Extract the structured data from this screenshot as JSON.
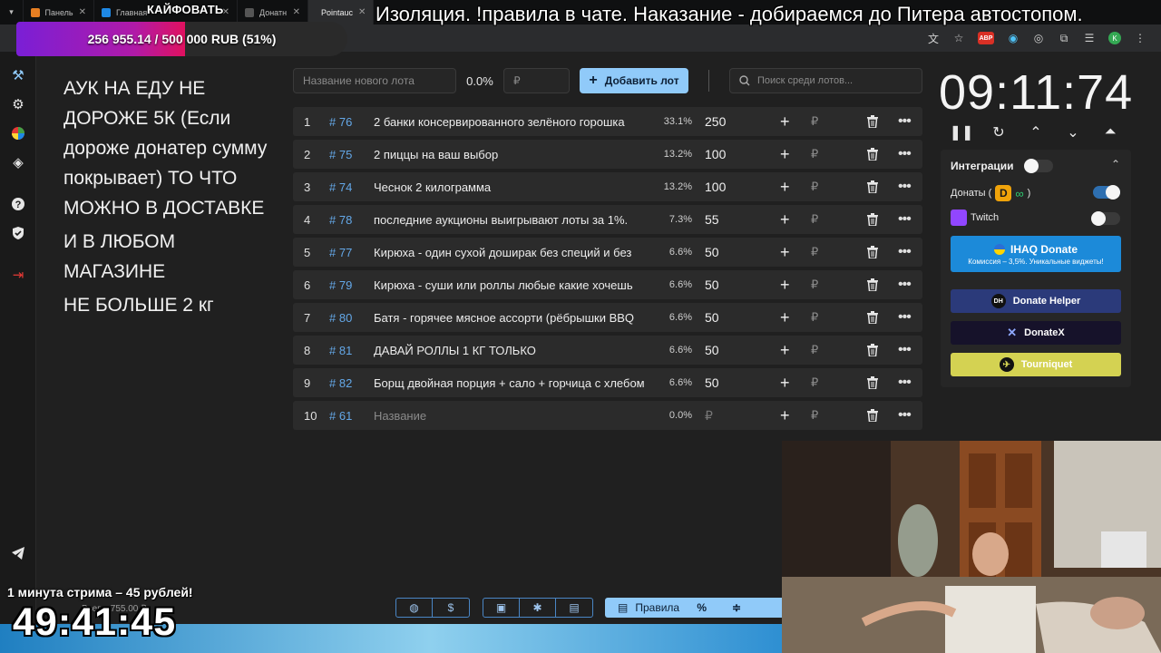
{
  "browser": {
    "tabs": [
      {
        "label": "Панель",
        "color": "#e67e22",
        "letter": "P"
      },
      {
        "label": "Главная",
        "color": "#1e88e5",
        "letter": "D"
      },
      {
        "label": "Донатн",
        "color": "#333333",
        "letter": "S"
      },
      {
        "label": "Pointauc",
        "color": "#9c27b0",
        "letter": "✺"
      }
    ]
  },
  "overlay": {
    "progress_text": "256 955.14 / 500 000 RUB (51%)",
    "progress_fraction": 0.51,
    "kayf": "КАЙФОВАТЬ",
    "marquee": "Изоляция. !правила в чате. Наказание - добираемся до Питера автостопом.",
    "minute_text": "1 минута стрима – 45 рублей!",
    "total_text": "Всего: 755.00 ₽",
    "big_timer": "49:41:45"
  },
  "rules": {
    "line1": "АУК НА ЕДУ НЕ ДОРОЖЕ 5К (Если дороже донатер сумму покрывает) ТО ЧТО МОЖНО В ДОСТАВКЕ",
    "line2": "И В ЛЮБОМ МАГАЗИНЕ",
    "line3": "НЕ БОЛЬШЕ 2 кг"
  },
  "controls": {
    "new_lot_placeholder": "Название нового лота",
    "percent": "0.0%",
    "amount_placeholder": "₽",
    "add_lot_label": "Добавить лот",
    "search_placeholder": "Поиск среди лотов..."
  },
  "lots": [
    {
      "num": "1",
      "id": "# 76",
      "name": "2 банки консервированного зелёного горошка",
      "pct": "33.1%",
      "amount": "250"
    },
    {
      "num": "2",
      "id": "# 75",
      "name": "2 пиццы на ваш выбор",
      "pct": "13.2%",
      "amount": "100"
    },
    {
      "num": "3",
      "id": "# 74",
      "name": "Чеснок 2 килограмма",
      "pct": "13.2%",
      "amount": "100"
    },
    {
      "num": "4",
      "id": "# 78",
      "name": "последние аукционы выигрывают лоты за 1%.",
      "pct": "7.3%",
      "amount": "55"
    },
    {
      "num": "5",
      "id": "# 77",
      "name": "Кирюха - один сухой доширак без специй и без",
      "pct": "6.6%",
      "amount": "50"
    },
    {
      "num": "6",
      "id": "# 79",
      "name": "Кирюха - суши или роллы любые какие хочешь",
      "pct": "6.6%",
      "amount": "50"
    },
    {
      "num": "7",
      "id": "# 80",
      "name": "Батя - горячее мясное ассорти (рёбрышки BBQ",
      "pct": "6.6%",
      "amount": "50"
    },
    {
      "num": "8",
      "id": "# 81",
      "name": "ДАВАЙ РОЛЛЫ 1 КГ ТОЛЬКО",
      "pct": "6.6%",
      "amount": "50"
    },
    {
      "num": "9",
      "id": "# 82",
      "name": "Борщ двойная порция + сало + горчица с хлебом",
      "pct": "6.6%",
      "amount": "50"
    },
    {
      "num": "10",
      "id": "# 61",
      "name": "Название",
      "pct": "0.0%",
      "amount": "₽",
      "placeholder": true
    }
  ],
  "lot_currency": "₽",
  "timer": "09:11:74",
  "integrations": {
    "title": "Интеграции",
    "donations_label": "Донаты (",
    "donations_suffix": ")",
    "donations_on": true,
    "twitch_label": "Twitch",
    "twitch_on": false,
    "ihaq_title": "IHAQ Donate",
    "ihaq_sub": "Комиссия – 3,5%. Уникальные виджеты!",
    "donate_helper": "Donate Helper",
    "donatex": "DonateX",
    "tourniquet": "Tourniquet"
  },
  "bottom": {
    "rules_label": "Правила"
  }
}
